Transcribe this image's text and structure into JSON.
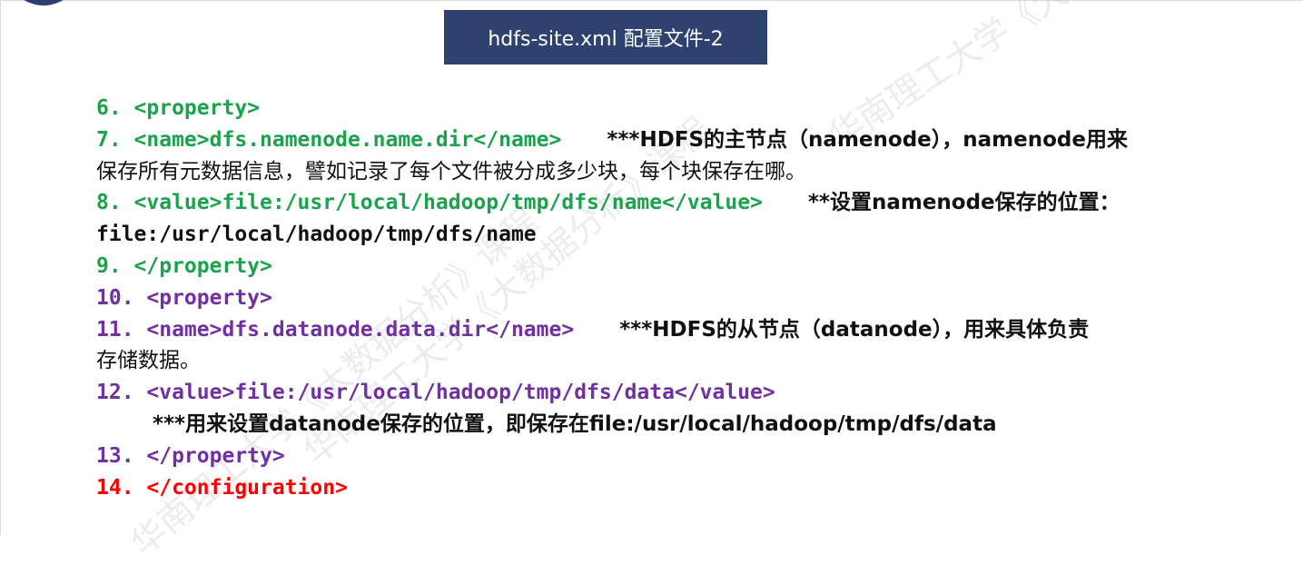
{
  "title": "hdfs-site.xml 配置文件-2",
  "lines": {
    "l6": "6. <property>",
    "l7_code": "7. <name>dfs.namenode.name.dir</name>",
    "l7_note": "***HDFS的主节点（namenode），namenode用来",
    "l7_cont": "保存所有元数据信息，譬如记录了每个文件被分成多少块，每个块保存在哪。",
    "l8_code": "8. <value>file:/usr/local/hadoop/tmp/dfs/name</value>",
    "l8_note": "**设置namenode保存的位置：",
    "l8_cont": "file:/usr/local/hadoop/tmp/dfs/name",
    "l9": "9. </property>",
    "l10": "10. <property>",
    "l11_code": "11. <name>dfs.datanode.data.dir</name>",
    "l11_note": "***HDFS的从节点（datanode），用来具体负责",
    "l11_cont": "存储数据。",
    "l12": "12. <value>file:/usr/local/hadoop/tmp/dfs/data</value>",
    "l12_note": "***用来设置datanode保存的位置，即保存在file:/usr/local/hadoop/tmp/dfs/data",
    "l13": "13. </property>",
    "l14": "14. </configuration>"
  },
  "watermark": "华南理工大学《大数据分析》课程",
  "colors": {
    "title_bg": "#2e416f",
    "green": "#1aa24c",
    "purple": "#7030a0",
    "red": "#ff0000",
    "text": "#111111"
  }
}
